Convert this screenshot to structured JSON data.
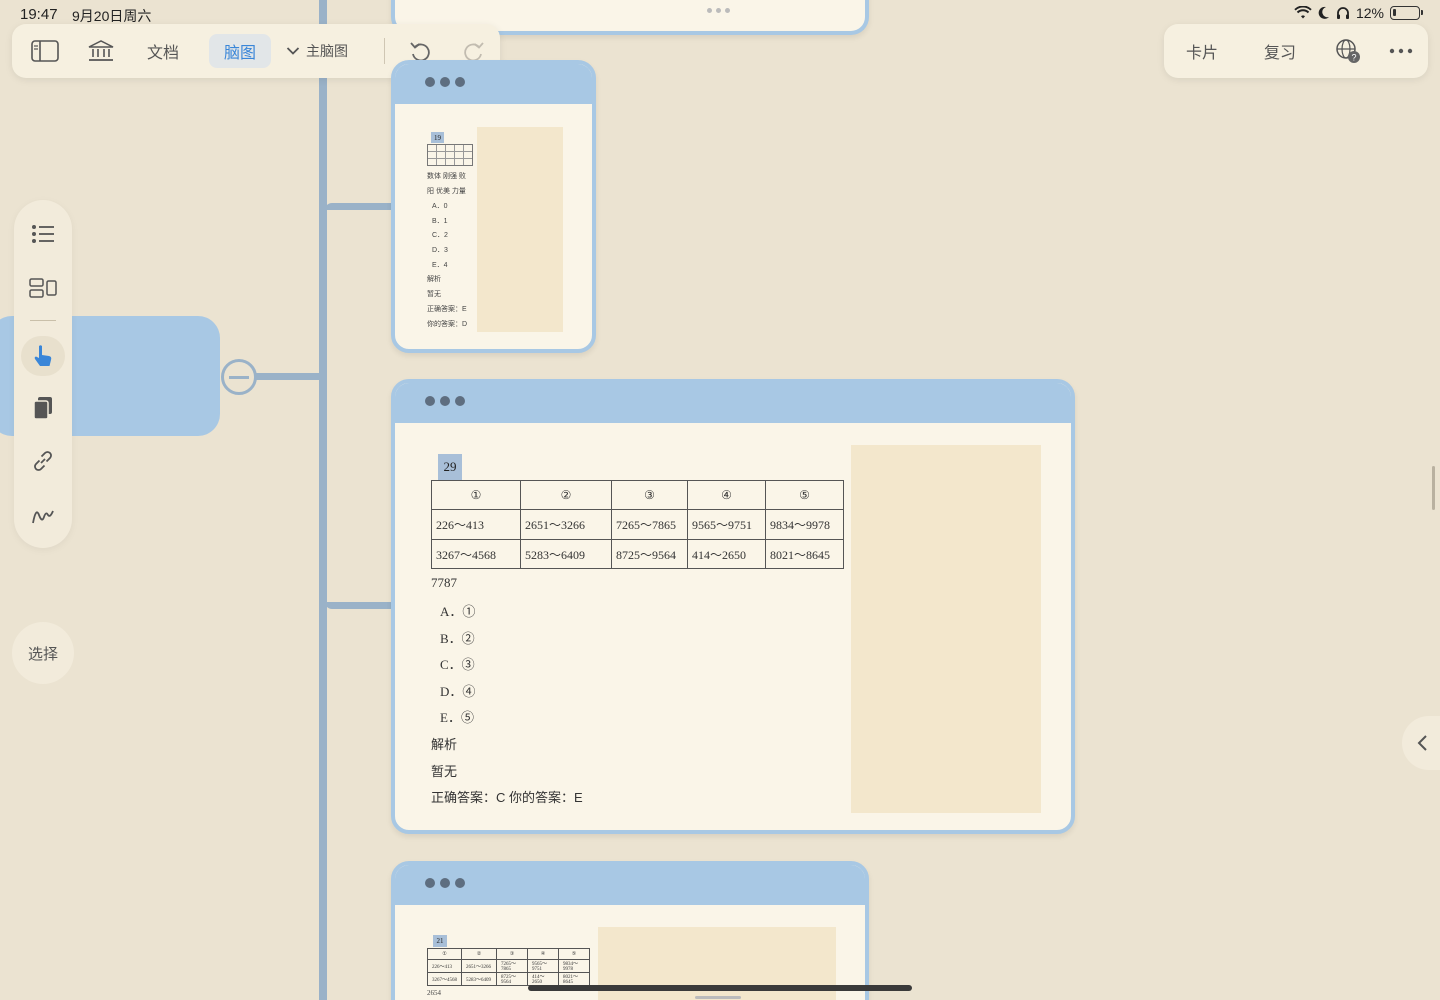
{
  "status": {
    "time": "19:47",
    "date": "9月20日周六",
    "battery": "12%"
  },
  "toolbar": {
    "doc_label": "文档",
    "mindmap_label": "脑图",
    "main_mindmap_label": "主脑图"
  },
  "toolbar_right": {
    "cards_label": "卡片",
    "review_label": "复习"
  },
  "sidebar": {
    "select_label": "选择"
  },
  "card_small_top": {
    "qnum": "19",
    "line1": "数体 刚强 败",
    "line2": "阳 优美 力量",
    "options": [
      "A．0",
      "B．1",
      "C．2",
      "D．3",
      "E．4"
    ],
    "analysis_label": "解析",
    "analysis_text": "暂无",
    "correct": "正确答案：E",
    "yours": "你的答案：D"
  },
  "card_main": {
    "qnum": "29",
    "table": {
      "headers": [
        "①",
        "②",
        "③",
        "④",
        "⑤"
      ],
      "rows": [
        [
          "226～413",
          "2651～3266",
          "7265～7865",
          "9565～9751",
          "9834～9978"
        ],
        [
          "3267～4568",
          "5283～6409",
          "8725～9564",
          "414～2650",
          "8021～8645"
        ]
      ]
    },
    "stem": "7787",
    "options": [
      "A．①",
      "B．②",
      "C．③",
      "D．④",
      "E．⑤"
    ],
    "analysis_label": "解析",
    "analysis_text": "暂无",
    "answer_line": "正确答案：C 你的答案：E"
  },
  "card_small_bottom": {
    "qnum": "21",
    "table": {
      "headers": [
        "①",
        "②",
        "③",
        "④",
        "⑤"
      ],
      "rows": [
        [
          "226～413",
          "2651～3266",
          "7265～7865",
          "9565～9751",
          "9834～9978"
        ],
        [
          "3267～4568",
          "5283～6409",
          "8725～9564",
          "414～2650",
          "8021～8645"
        ]
      ]
    },
    "stem": "2654"
  }
}
